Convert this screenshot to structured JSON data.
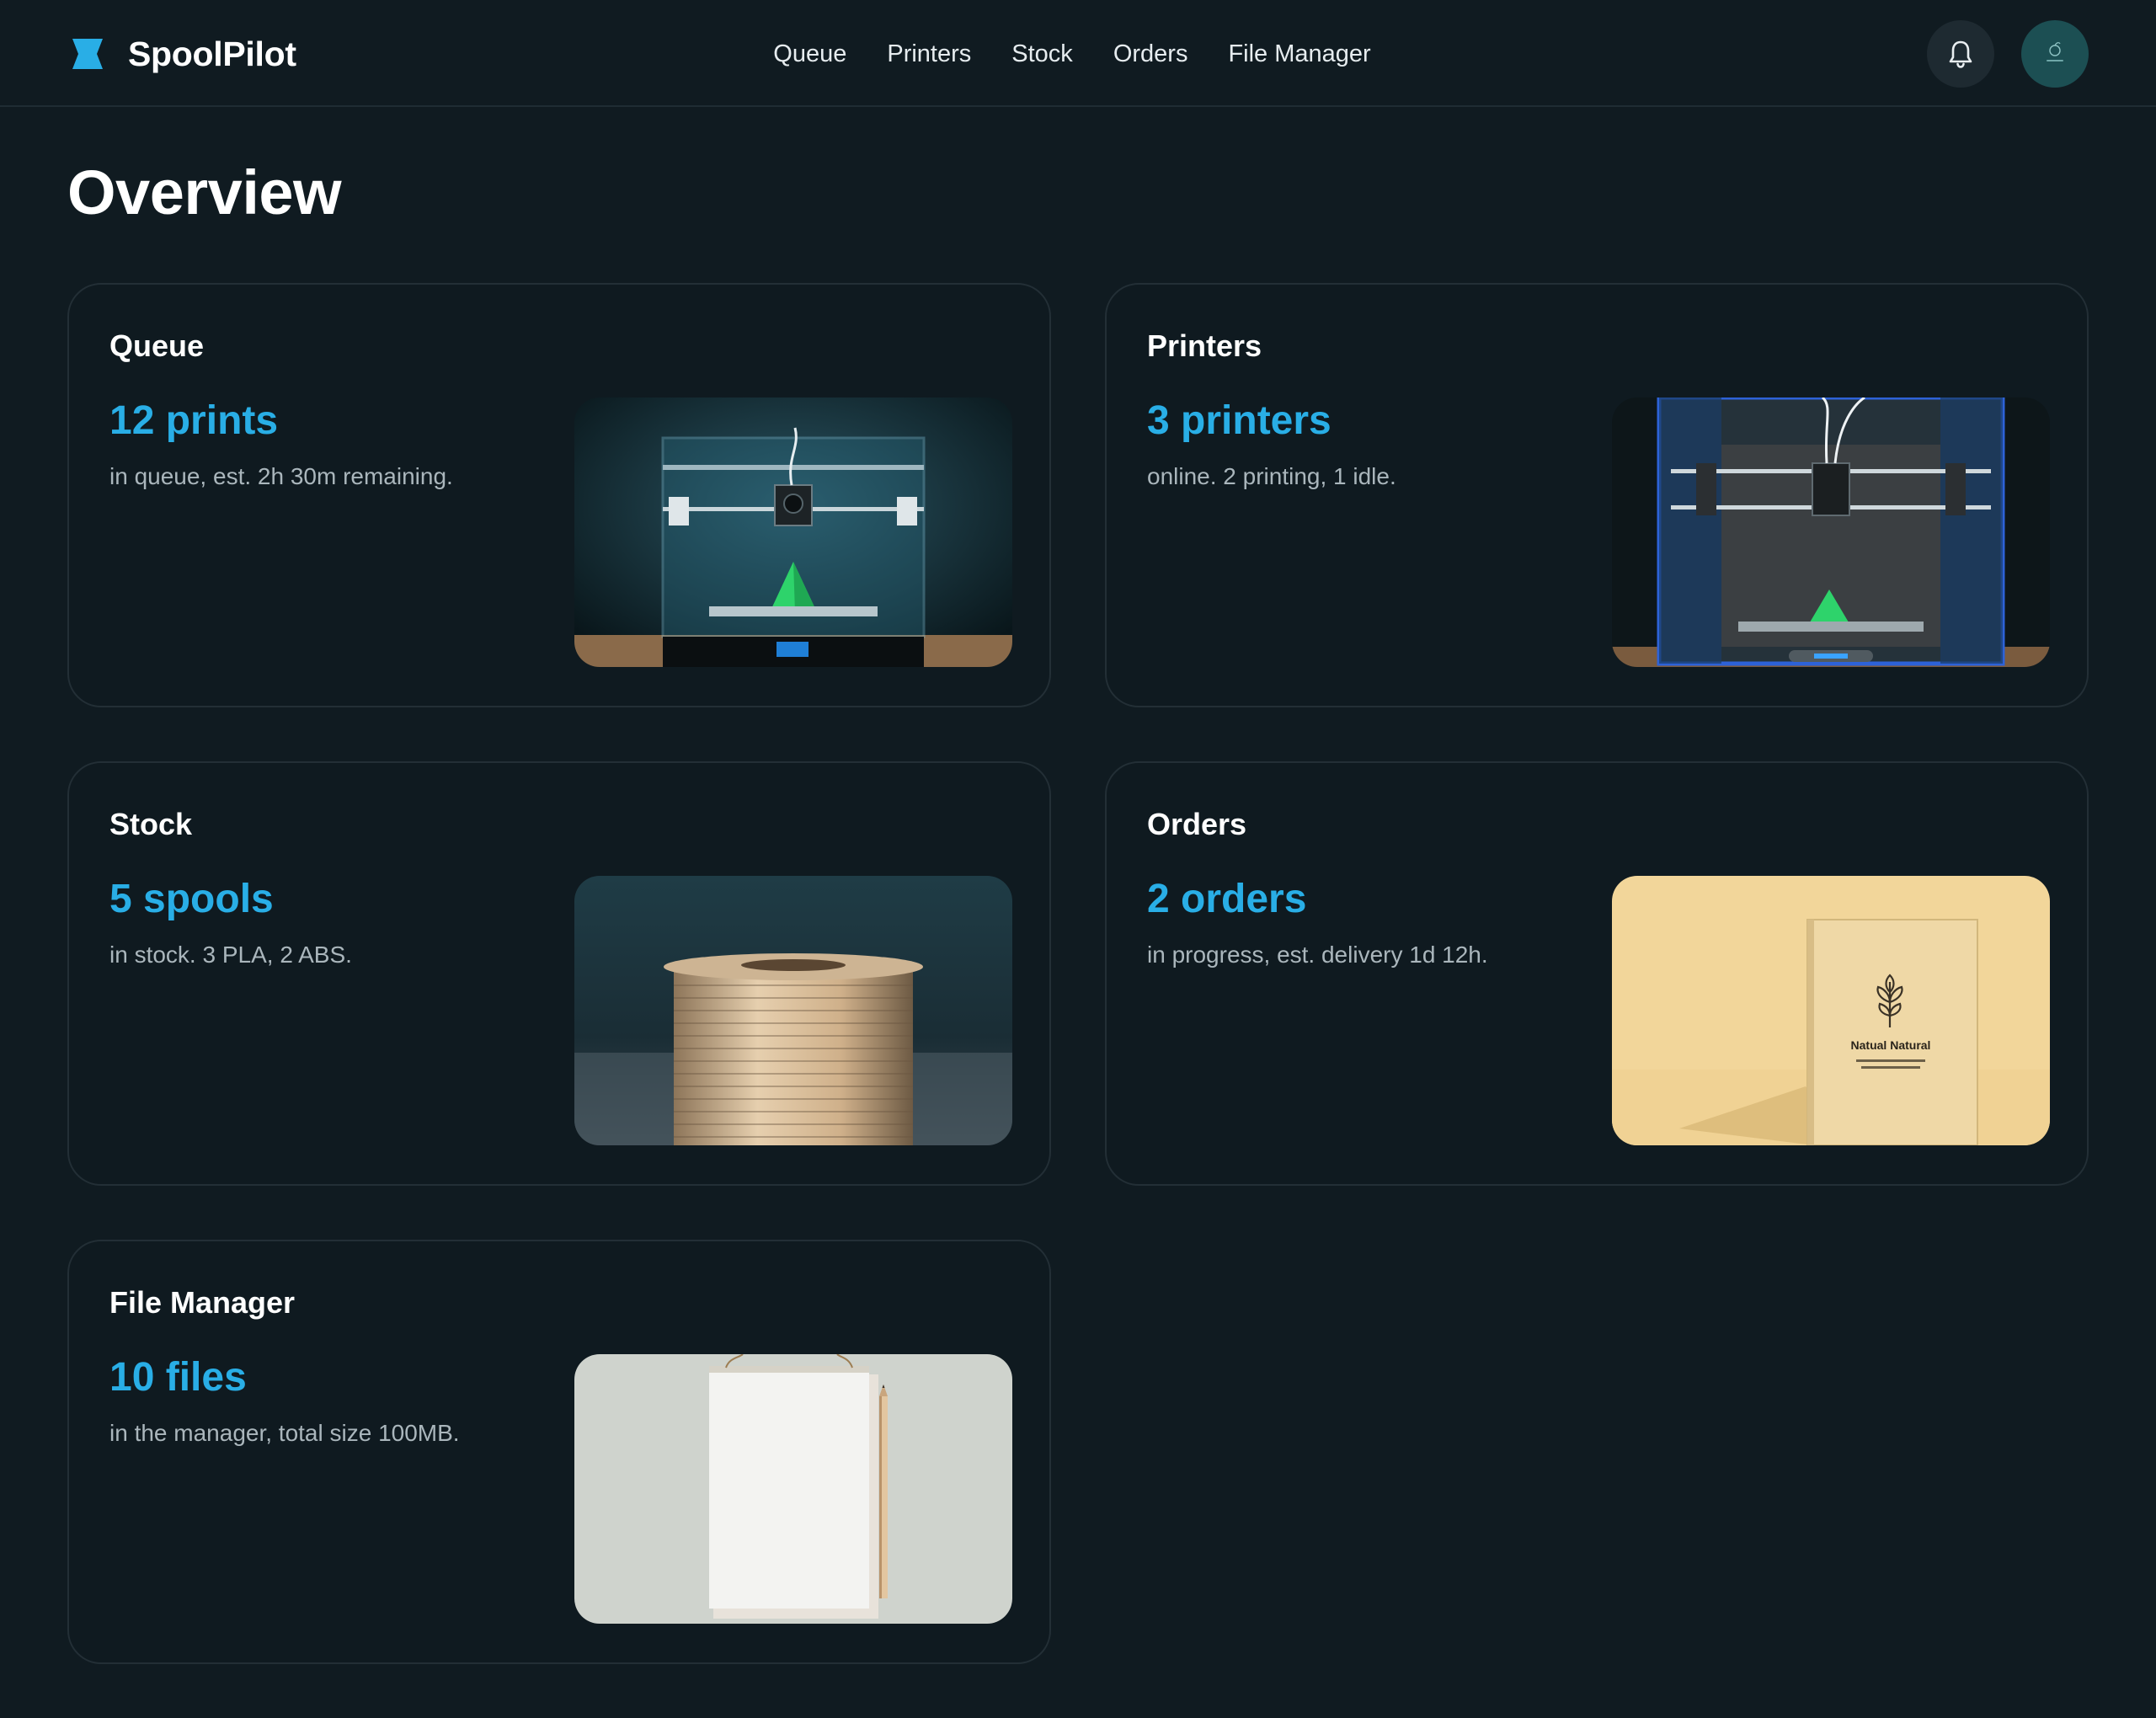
{
  "app": {
    "name": "SpoolPilot",
    "logo_icon": "spool-logo-icon",
    "accent": "#29aee6"
  },
  "nav": {
    "items": [
      {
        "label": "Queue"
      },
      {
        "label": "Printers"
      },
      {
        "label": "Stock"
      },
      {
        "label": "Orders"
      },
      {
        "label": "File Manager"
      }
    ]
  },
  "header_actions": {
    "notifications_icon": "bell-icon",
    "avatar_icon": "avatar-icon"
  },
  "page": {
    "title": "Overview"
  },
  "cards": [
    {
      "title": "Queue",
      "count": "12 prints",
      "description": "in queue, est. 2h 30m remaining.",
      "image": "3d-printer-photo"
    },
    {
      "title": "Printers",
      "count": "3 printers",
      "description": "online. 2 printing, 1 idle.",
      "image": "3d-printer-enclosure-photo"
    },
    {
      "title": "Stock",
      "count": "5 spools",
      "description": "in stock. 3 PLA, 2 ABS.",
      "image": "filament-spool-photo"
    },
    {
      "title": "Orders",
      "count": "2 orders",
      "description": "in progress, est. delivery 1d 12h.",
      "image": "product-box-photo",
      "box_label": "Natual Natural"
    },
    {
      "title": "File Manager",
      "count": "10 files",
      "description": "in the manager, total size 100MB.",
      "image": "notepad-pencil-photo"
    }
  ]
}
